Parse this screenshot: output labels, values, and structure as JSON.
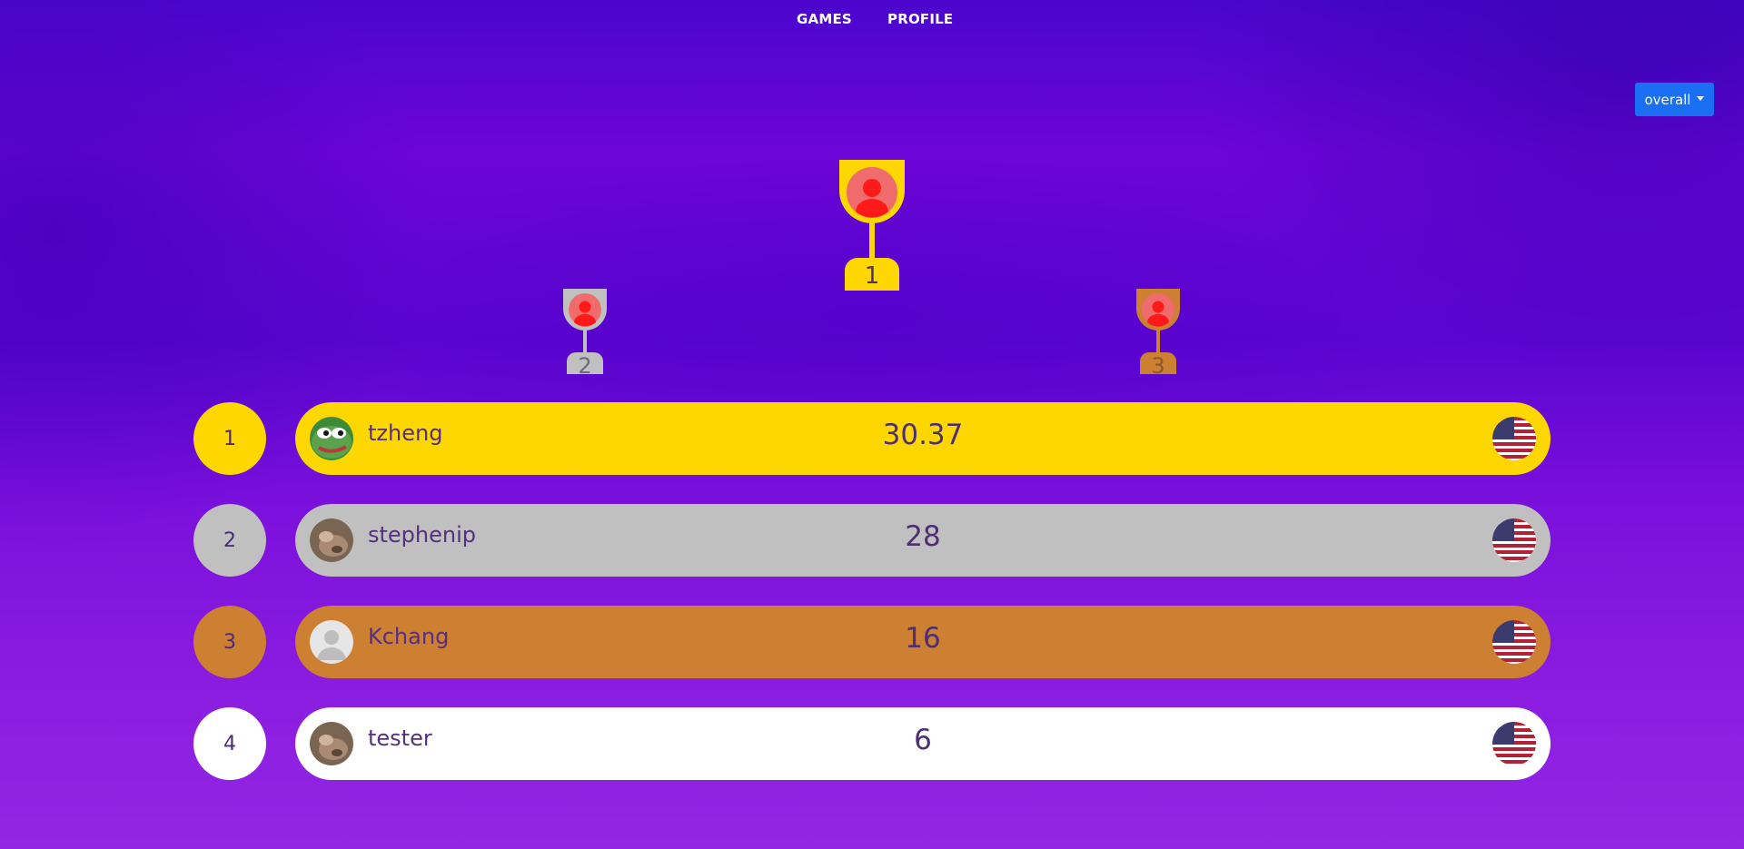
{
  "nav": {
    "games": "GAMES",
    "profile": "PROFILE"
  },
  "filter": {
    "selected": "overall"
  },
  "podium": [
    {
      "place": "1",
      "color": "#ffd700"
    },
    {
      "place": "2",
      "color": "#c0c0c0"
    },
    {
      "place": "3",
      "color": "#cd7f32"
    }
  ],
  "leaderboard": [
    {
      "rank": "1",
      "username": "tzheng",
      "score": "30.37",
      "color": "#ffd700",
      "avatar": "frog-avatar",
      "country": "us-flag-icon"
    },
    {
      "rank": "2",
      "username": "stephenip",
      "score": "28",
      "color": "#c0c0c0",
      "avatar": "photo-avatar",
      "country": "us-flag-icon"
    },
    {
      "rank": "3",
      "username": "Kchang",
      "score": "16",
      "color": "#cd7f32",
      "avatar": "default-avatar",
      "country": "us-flag-icon"
    },
    {
      "rank": "4",
      "username": "tester",
      "score": "6",
      "color": "#ffffff",
      "avatar": "photo-avatar",
      "country": "us-flag-icon"
    }
  ]
}
